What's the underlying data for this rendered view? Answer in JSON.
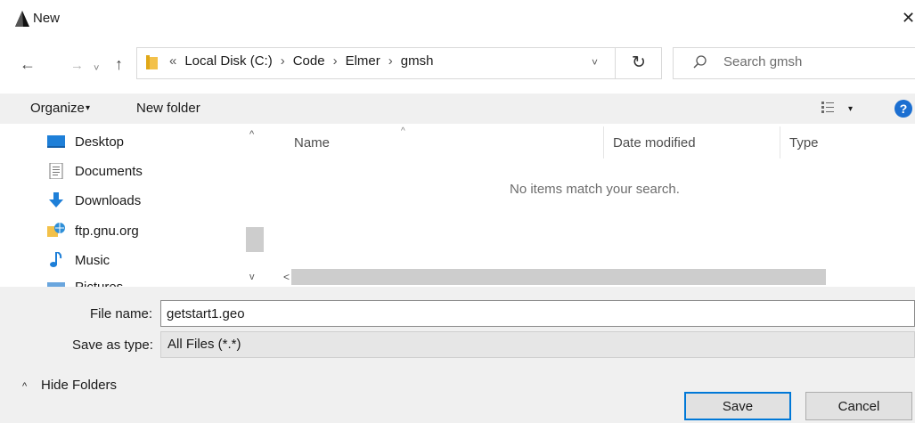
{
  "window": {
    "title": "New",
    "close_glyph": "✕"
  },
  "nav": {
    "back_glyph": "←",
    "forward_glyph": "→",
    "recent_glyph": "˅",
    "up_glyph": "↑"
  },
  "address": {
    "overflow": "«",
    "separator": "›",
    "items": [
      "Local Disk (C:)",
      "Code",
      "Elmer",
      "gmsh"
    ],
    "dropdown_glyph": "˅",
    "refresh_glyph": "↻"
  },
  "search": {
    "placeholder": "Search gmsh"
  },
  "toolbar": {
    "organize_label": "Organize",
    "organize_caret": "▾",
    "new_folder_label": "New folder",
    "view_caret": "▾",
    "help_glyph": "?"
  },
  "sidebar": {
    "items": [
      {
        "label": "Desktop",
        "icon": "desktop-icon"
      },
      {
        "label": "Documents",
        "icon": "documents-icon"
      },
      {
        "label": "Downloads",
        "icon": "downloads-icon"
      },
      {
        "label": "ftp.gnu.org",
        "icon": "network-location-icon"
      },
      {
        "label": "Music",
        "icon": "music-icon"
      },
      {
        "label": "Pictures",
        "icon": "pictures-icon"
      }
    ],
    "scroll_up_glyph": "^",
    "scroll_down_glyph": "v"
  },
  "filelist": {
    "columns": [
      "Name",
      "Date modified",
      "Type"
    ],
    "sort_glyph": "^",
    "empty_message": "No items match your search.",
    "hscroll_left_glyph": "<"
  },
  "form": {
    "file_name_label": "File name:",
    "file_name_value": "getstart1.geo",
    "save_type_label": "Save as type:",
    "save_type_value": "All Files (*.*)"
  },
  "footer": {
    "hide_folders_label": "Hide Folders",
    "hide_caret": "^",
    "save_label": "Save",
    "cancel_label": "Cancel"
  },
  "colors": {
    "accent": "#0078d7",
    "help": "#1c6fd1",
    "folder": "#f3c14a",
    "toolbar_bg": "#f0f0f0"
  }
}
